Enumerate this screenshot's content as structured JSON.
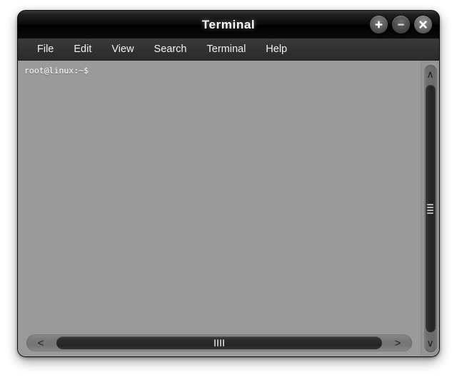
{
  "window": {
    "title": "Terminal",
    "controls": [
      {
        "name": "maximize-button",
        "icon": "plus-icon",
        "label": "+"
      },
      {
        "name": "minimize-button",
        "icon": "minus-icon",
        "label": "−"
      },
      {
        "name": "close-button",
        "icon": "close-icon",
        "label": "✕"
      }
    ]
  },
  "menubar": {
    "items": [
      {
        "label": "File"
      },
      {
        "label": "Edit"
      },
      {
        "label": "View"
      },
      {
        "label": "Search"
      },
      {
        "label": "Terminal"
      },
      {
        "label": "Help"
      }
    ]
  },
  "terminal": {
    "lines": [
      "root@linux:~$"
    ],
    "background_color": "#9a9a9a",
    "text_color": "#ffffff"
  },
  "scrollbars": {
    "vertical": {
      "up_arrow": "∧",
      "down_arrow": "∨",
      "grip_lines": 4
    },
    "horizontal": {
      "left_arrow": "<",
      "right_arrow": ">",
      "grip_lines": 4
    }
  },
  "colors": {
    "titlebar": "#000000",
    "menubar": "#313131",
    "content": "#9a9a9a",
    "chrome": "#2b2b2b"
  }
}
